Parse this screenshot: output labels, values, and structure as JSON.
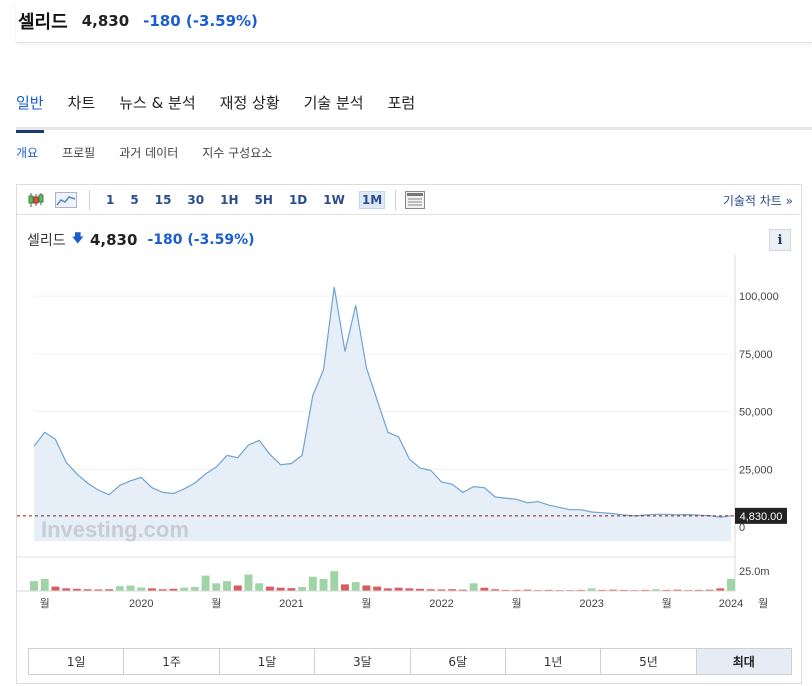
{
  "header": {
    "name": "셀리드",
    "price": "4,830",
    "change": "-180",
    "change_pct": "(-3.59%)"
  },
  "main_tabs": [
    "일반",
    "차트",
    "뉴스 & 분석",
    "재정 상황",
    "기술 분석",
    "포럼"
  ],
  "sub_tabs": [
    "개요",
    "프로필",
    "과거 데이터",
    "지수 구성요소"
  ],
  "toolbar": {
    "timeframes": [
      "1",
      "5",
      "15",
      "30",
      "1H",
      "5H",
      "1D",
      "1W",
      "1M"
    ],
    "active_timeframe": "1M",
    "tech_chart_link": "기술적 차트 »"
  },
  "quote": {
    "name": "셀리드",
    "price": "4,830",
    "change": "-180",
    "change_pct": "(-3.59%)"
  },
  "info_label": "i",
  "ranges": [
    "1일",
    "1주",
    "1달",
    "3달",
    "6달",
    "1년",
    "5년",
    "최대"
  ],
  "active_range": "최대",
  "watermark": "Investing.com",
  "colors": {
    "accent": "#1a5dd1",
    "line": "#6fa3d2",
    "area": "#e6eef7",
    "vol_up": "#9fd4a6",
    "vol_down": "#d95b5b",
    "last_line": "#8b1a1a"
  },
  "chart_data": {
    "type": "area",
    "x_tick_labels": [
      "월",
      "2020",
      "월",
      "2021",
      "월",
      "2022",
      "월",
      "2023",
      "월",
      "2024",
      "월"
    ],
    "y_tick_labels": [
      "100,000",
      "75,000",
      "50,000",
      "25,000",
      "0"
    ],
    "ylim": [
      0,
      110000
    ],
    "last_value_label": "4,830.00",
    "last_value": 4830,
    "volume_label": "25.0m",
    "series": [
      {
        "values": [
          35000,
          41000,
          38000,
          28000,
          23000,
          19000,
          16000,
          14000,
          18000,
          20000,
          21500,
          17000,
          15000,
          14500,
          16500,
          19000,
          23000,
          26000,
          31000,
          30000,
          35500,
          37500,
          31500,
          27000,
          27500,
          31000,
          57000,
          68000,
          104000,
          76000,
          96000,
          69000,
          55000,
          41000,
          39000,
          29500,
          25500,
          24500,
          19500,
          18500,
          15000,
          17500,
          17000,
          13000,
          12500,
          12000,
          10500,
          11000,
          9500,
          8500,
          7500,
          7500,
          6500,
          6200,
          5800,
          5200,
          4800,
          5200,
          5500,
          5500,
          5300,
          5400,
          5100,
          4900,
          4300,
          4830
        ]
      }
    ],
    "volume": [
      {
        "v": 4.5,
        "up": true
      },
      {
        "v": 5.5,
        "up": true
      },
      {
        "v": 2.0,
        "up": false
      },
      {
        "v": 1.2,
        "up": false
      },
      {
        "v": 1.0,
        "up": false
      },
      {
        "v": 0.8,
        "up": false
      },
      {
        "v": 0.7,
        "up": false
      },
      {
        "v": 0.8,
        "up": false
      },
      {
        "v": 2.2,
        "up": true
      },
      {
        "v": 2.5,
        "up": true
      },
      {
        "v": 1.6,
        "up": true
      },
      {
        "v": 1.2,
        "up": false
      },
      {
        "v": 0.8,
        "up": false
      },
      {
        "v": 1.0,
        "up": false
      },
      {
        "v": 1.5,
        "up": true
      },
      {
        "v": 1.8,
        "up": true
      },
      {
        "v": 7.0,
        "up": true
      },
      {
        "v": 3.5,
        "up": true
      },
      {
        "v": 4.5,
        "up": true
      },
      {
        "v": 2.5,
        "up": false
      },
      {
        "v": 7.5,
        "up": true
      },
      {
        "v": 3.5,
        "up": true
      },
      {
        "v": 2.0,
        "up": false
      },
      {
        "v": 1.5,
        "up": false
      },
      {
        "v": 1.3,
        "up": false
      },
      {
        "v": 1.8,
        "up": true
      },
      {
        "v": 6.5,
        "up": true
      },
      {
        "v": 5.5,
        "up": true
      },
      {
        "v": 9.0,
        "up": true
      },
      {
        "v": 3.0,
        "up": false
      },
      {
        "v": 4.0,
        "up": true
      },
      {
        "v": 2.5,
        "up": false
      },
      {
        "v": 2.0,
        "up": false
      },
      {
        "v": 1.2,
        "up": false
      },
      {
        "v": 1.5,
        "up": false
      },
      {
        "v": 1.2,
        "up": false
      },
      {
        "v": 1.0,
        "up": false
      },
      {
        "v": 0.8,
        "up": false
      },
      {
        "v": 0.7,
        "up": false
      },
      {
        "v": 0.8,
        "up": false
      },
      {
        "v": 0.6,
        "up": false
      },
      {
        "v": 3.5,
        "up": true
      },
      {
        "v": 1.5,
        "up": false
      },
      {
        "v": 0.8,
        "up": false
      },
      {
        "v": 0.5,
        "up": false
      },
      {
        "v": 0.5,
        "up": false
      },
      {
        "v": 0.6,
        "up": false
      },
      {
        "v": 0.4,
        "up": false
      },
      {
        "v": 0.5,
        "up": false
      },
      {
        "v": 0.4,
        "up": false
      },
      {
        "v": 0.4,
        "up": false
      },
      {
        "v": 0.5,
        "up": false
      },
      {
        "v": 1.2,
        "up": true
      },
      {
        "v": 0.5,
        "up": false
      },
      {
        "v": 0.6,
        "up": false
      },
      {
        "v": 0.5,
        "up": false
      },
      {
        "v": 0.4,
        "up": false
      },
      {
        "v": 0.5,
        "up": false
      },
      {
        "v": 0.8,
        "up": true
      },
      {
        "v": 0.5,
        "up": false
      },
      {
        "v": 0.6,
        "up": false
      },
      {
        "v": 0.4,
        "up": false
      },
      {
        "v": 0.5,
        "up": false
      },
      {
        "v": 0.6,
        "up": false
      },
      {
        "v": 1.2,
        "up": false
      },
      {
        "v": 5.5,
        "up": true
      }
    ]
  }
}
